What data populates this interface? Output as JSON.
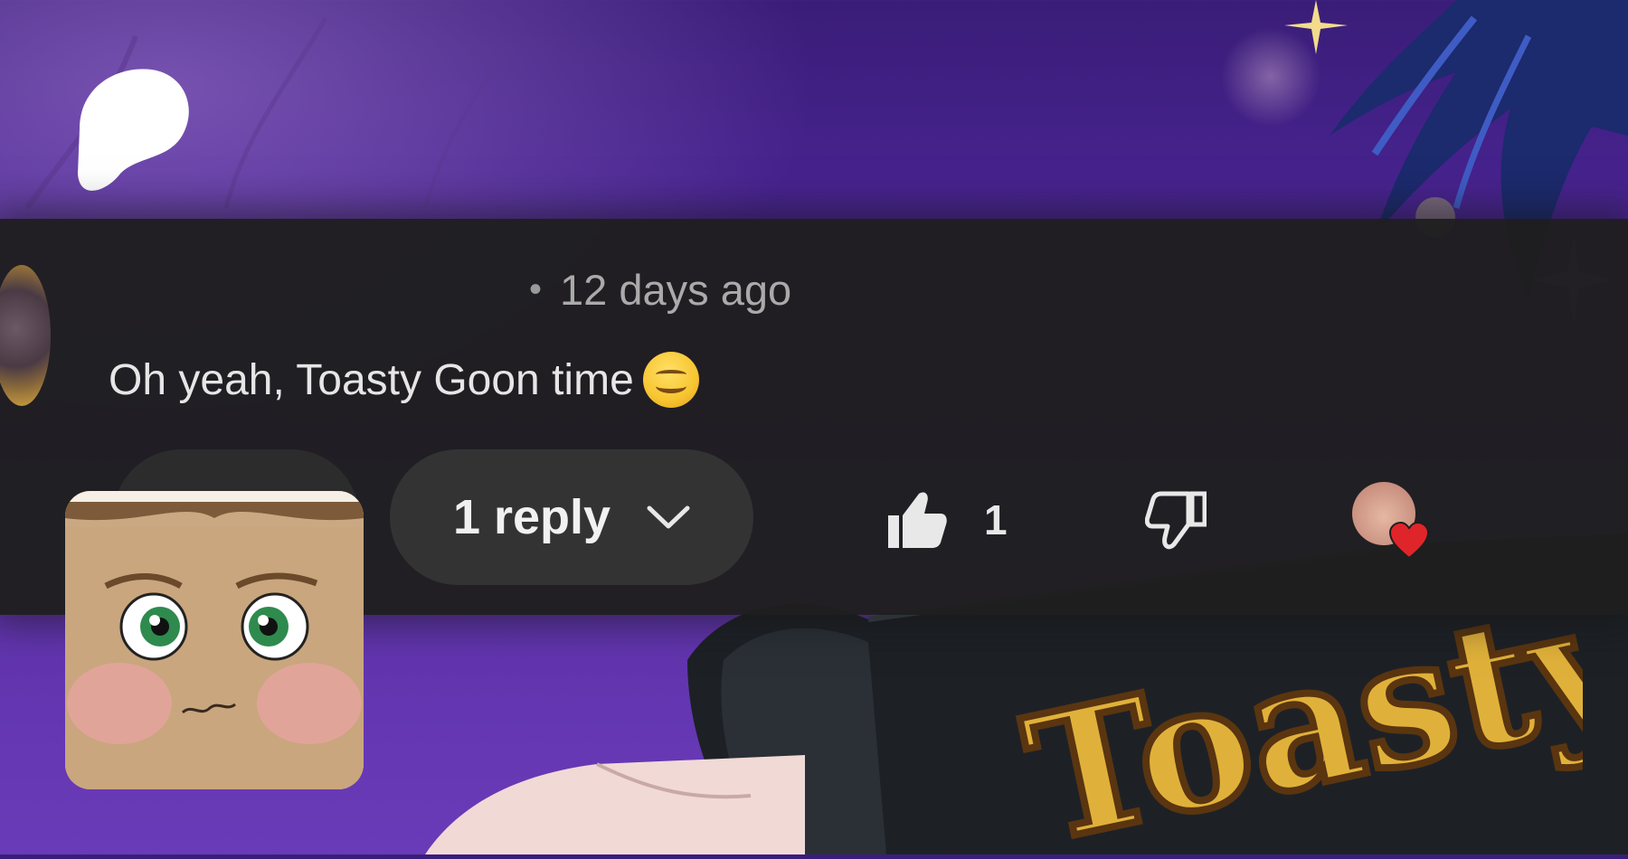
{
  "comment": {
    "meta_separator": "•",
    "timestamp": "12 days ago",
    "text": "Oh yeah, Toasty Goon time",
    "replies_label": "1 reply",
    "like_count": "1"
  },
  "artwork": {
    "sleeve_text": "Toasty"
  },
  "colors": {
    "background_purple": "#47238f",
    "panel": "#1e1e1e",
    "reply_pill": "#333333",
    "text_primary": "#e6e6e6",
    "text_secondary": "#aaaaaa",
    "toasty_gold": "#e0b13a"
  },
  "icons": {
    "logo": "patreon-logo-icon",
    "expand": "chevron-down-icon",
    "like": "thumbs-up-icon",
    "dislike": "thumbs-down-icon",
    "creator_heart": "heart-icon"
  }
}
